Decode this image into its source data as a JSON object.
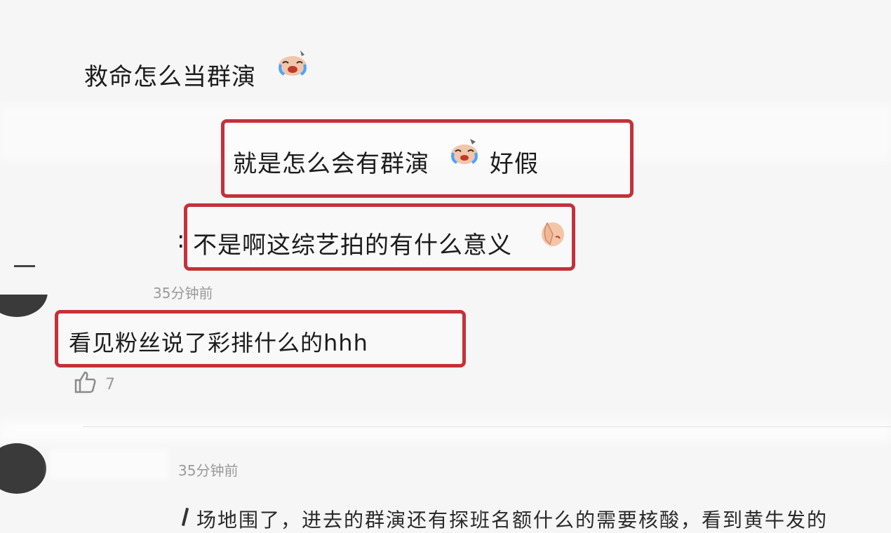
{
  "comments": [
    {
      "text": "救命怎么当群演",
      "emoji": "crying-face-icon"
    },
    {
      "text": "就是怎么会有群演",
      "emoji": "crying-face-icon",
      "suffix": "好假"
    },
    {
      "prefix": ":",
      "text": "不是啊这综艺拍的有什么意义",
      "emoji": "facepalm-icon"
    },
    {
      "time": "35分钟前",
      "text": "看见粉丝说了彩排什么的hhh",
      "likes": "7"
    },
    {
      "time": "35分钟前",
      "text": "场地围了，进去的群演还有探班名额什么的需要核酸，看到黄牛发的"
    }
  ],
  "colors": {
    "highlight_box": "#c4313a",
    "meta_text": "#9a9a9a",
    "like_icon": "#9a9a9a"
  }
}
